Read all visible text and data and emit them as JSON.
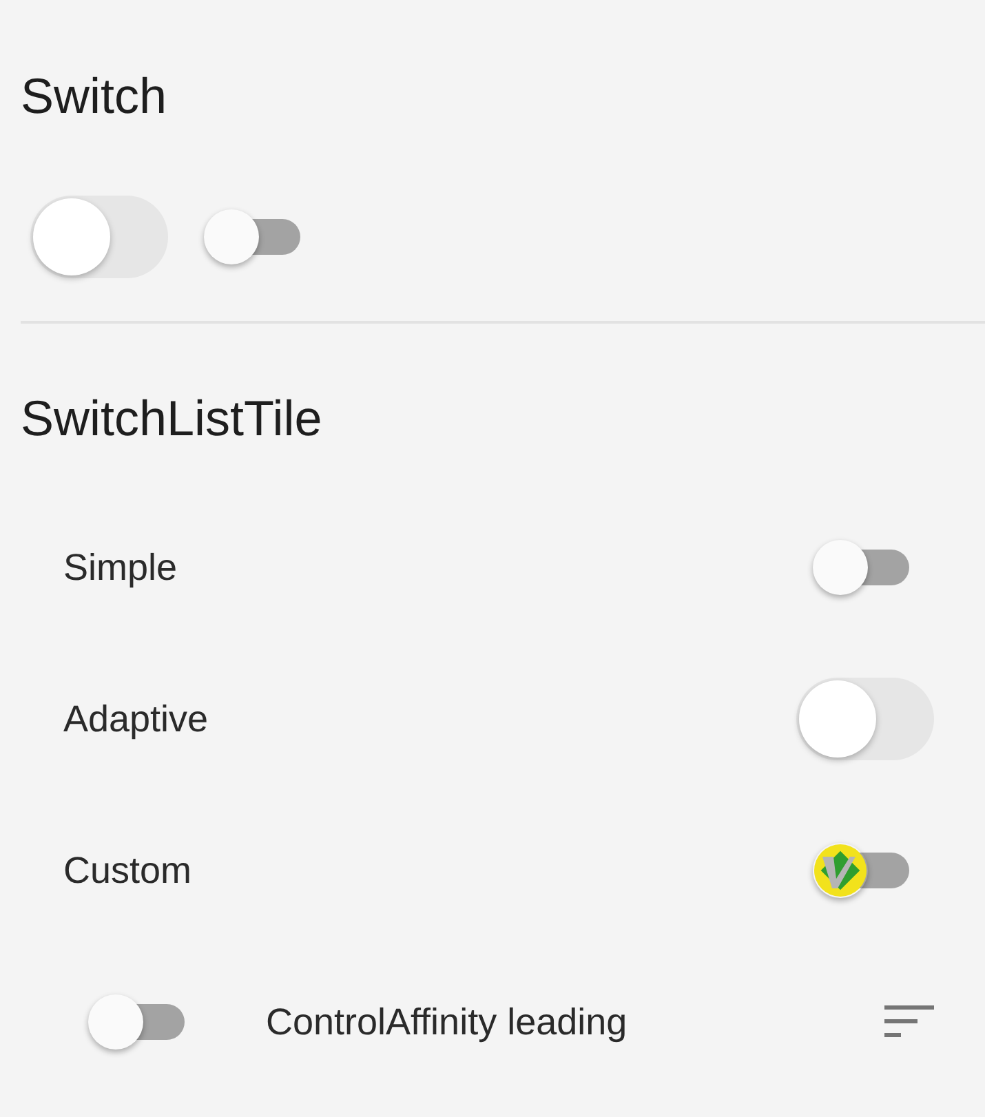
{
  "sections": [
    {
      "title": "Switch",
      "kind": "plain",
      "switches": [
        {
          "kind": "adaptive",
          "on": false
        },
        {
          "kind": "material",
          "on": false
        }
      ]
    },
    {
      "title": "SwitchListTile",
      "kind": "tiles",
      "tiles": [
        {
          "label": "Simple",
          "kind": "trailing",
          "switch": {
            "kind": "material",
            "on": false
          }
        },
        {
          "label": "Adaptive",
          "kind": "trailing",
          "switch": {
            "kind": "adaptive",
            "on": false
          }
        },
        {
          "label": "Custom",
          "kind": "trailing",
          "switch": {
            "kind": "custom",
            "on": false
          }
        },
        {
          "label": "ControlAffinity leading",
          "kind": "leading",
          "switch": {
            "kind": "material",
            "on": false
          },
          "trailing_icon": true
        }
      ]
    }
  ]
}
